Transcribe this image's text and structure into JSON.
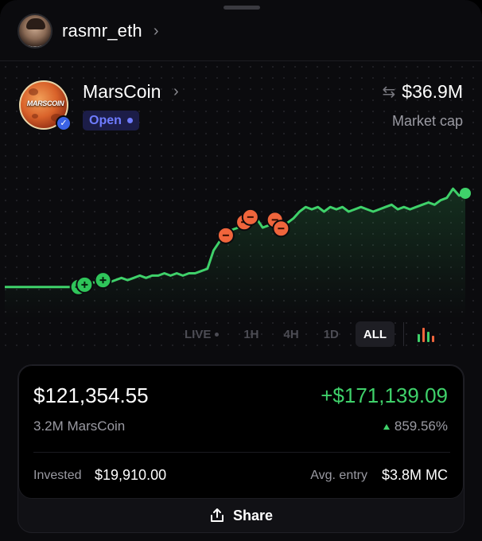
{
  "user": {
    "username": "rasmr_eth",
    "chevron_icon": "chevron-right-icon"
  },
  "coin": {
    "name": "MarsCoin",
    "logo_text": "MARSCOIN",
    "status": "Open",
    "market_cap_value": "$36.9M",
    "market_cap_label": "Market cap"
  },
  "timeframes": {
    "live": "LIVE",
    "h1": "1H",
    "h4": "4H",
    "d1": "1D",
    "all": "ALL",
    "selected": "ALL"
  },
  "chart_data": {
    "type": "line",
    "y": [
      6,
      6,
      6,
      6,
      6,
      6,
      6,
      6,
      6,
      6,
      6,
      6,
      6,
      7,
      8,
      8,
      9,
      8,
      9,
      10,
      9,
      10,
      11,
      10,
      11,
      11,
      12,
      11,
      12,
      11,
      12,
      12,
      13,
      14,
      22,
      26,
      30,
      31,
      32,
      33,
      38,
      36,
      32,
      33,
      34,
      33,
      34,
      36,
      39,
      41,
      40,
      41,
      39,
      41,
      40,
      41,
      39,
      40,
      41,
      40,
      39,
      40,
      41,
      42,
      40,
      41,
      40,
      41,
      42,
      43,
      42,
      44,
      45,
      49,
      46,
      47
    ],
    "markers": [
      {
        "index": 12,
        "type": "buy"
      },
      {
        "index": 13,
        "type": "buy"
      },
      {
        "index": 16,
        "type": "buy"
      },
      {
        "index": 36,
        "type": "sell"
      },
      {
        "index": 39,
        "type": "sell"
      },
      {
        "index": 40,
        "type": "sell"
      },
      {
        "index": 44,
        "type": "sell"
      },
      {
        "index": 45,
        "type": "sell"
      }
    ],
    "ylim": [
      0,
      55
    ],
    "line_color": "#3fd16a",
    "buy_color": "#2fc55a",
    "sell_color": "#f0653c",
    "grid": false
  },
  "position": {
    "value": "$121,354.55",
    "amount": "3.2M MarsCoin",
    "pnl": "+$171,139.09",
    "pnl_percent": "859.56%",
    "invested_label": "Invested",
    "invested_value": "$19,910.00",
    "avg_entry_label": "Avg. entry",
    "avg_entry_value": "$3.8M MC"
  },
  "share_label": "Share",
  "colors": {
    "accent_green": "#3fd16a",
    "badge_blue": "#6f7cff",
    "sell_orange": "#f0653c"
  }
}
